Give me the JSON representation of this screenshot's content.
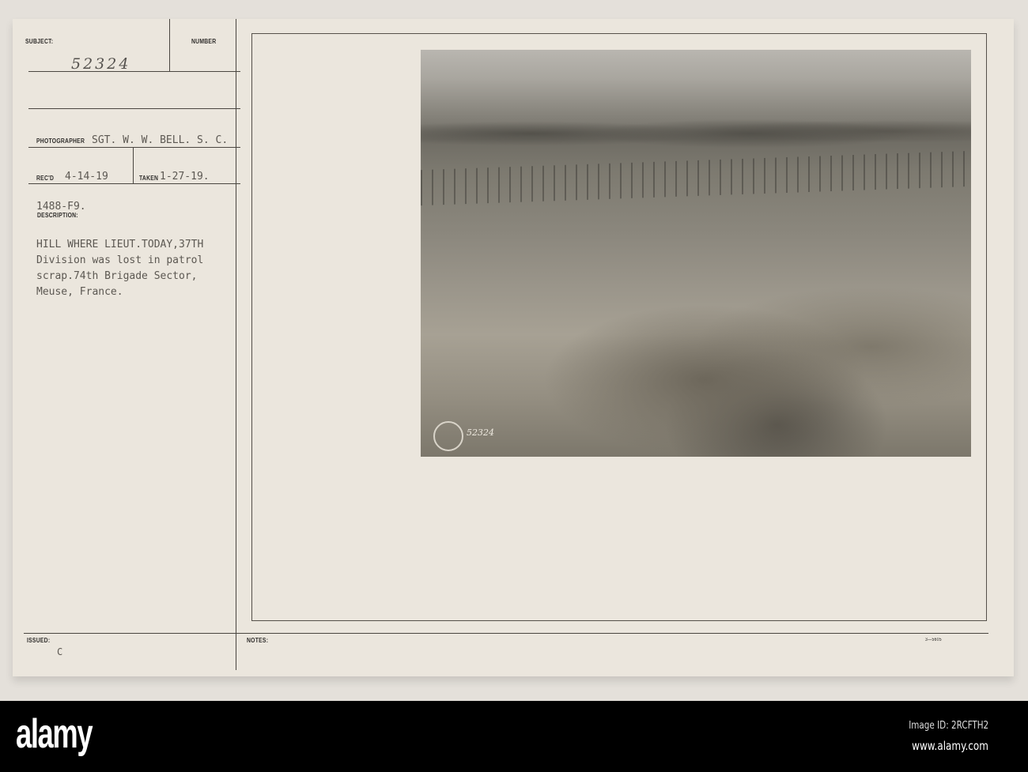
{
  "card": {
    "subject_label": "SUBJECT:",
    "subject_value": "52324",
    "number_label": "NUMBER",
    "photographer_label": "PHOTOGRAPHER",
    "photographer_value": "SGT. W. W. BELL. S. C.",
    "recd_label": "REC'D",
    "recd_value": "4-14-19",
    "taken_label": "TAKEN",
    "taken_value": "1-27-19.",
    "file_code": "1488-F9.",
    "description_label": "DESCRIPTION:",
    "description_lines": [
      "HILL WHERE LIEUT.TODAY,37TH",
      "Division was lost in patrol",
      "scrap.74th Brigade Sector,",
      "Meuse, France."
    ],
    "issued_label": "ISSUED:",
    "issued_value": "C",
    "notes_label": "NOTES:",
    "form_number": "3—5605",
    "photo_number": "52324"
  },
  "footer": {
    "logo": "alamy",
    "image_id": "Image ID: 2RCFTH2",
    "website": "www.alamy.com"
  }
}
